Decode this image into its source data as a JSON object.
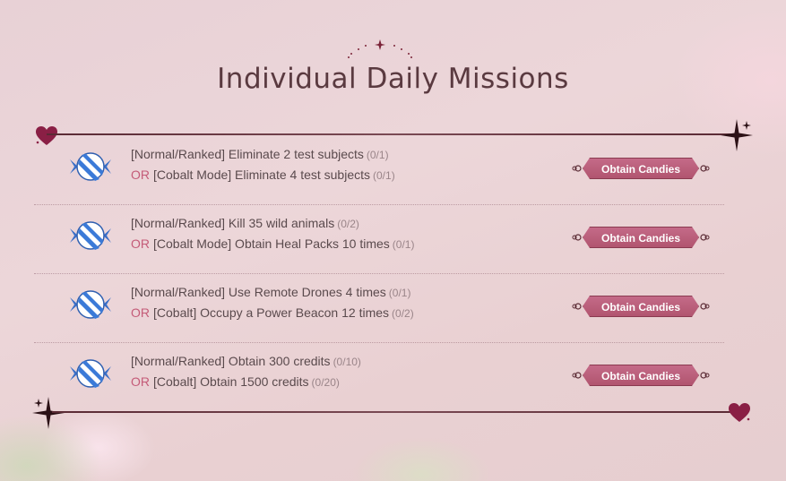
{
  "title": "Individual Daily Missions",
  "colors": {
    "accent": "#b1556f",
    "or_text": "#c45b78",
    "divider": "#5a2a34",
    "heart": "#8a1f45"
  },
  "missions": [
    {
      "line1": "[Normal/Ranked] Eliminate 2 test subjects",
      "progress1": "(0/1)",
      "or_label": "OR",
      "line2": "[Cobalt Mode] Eliminate 4 test subjects",
      "progress2": "(0/1)",
      "button": "Obtain Candies",
      "icon": "candy-icon"
    },
    {
      "line1": "[Normal/Ranked] Kill 35 wild animals",
      "progress1": "(0/2)",
      "or_label": "OR",
      "line2": "[Cobalt Mode] Obtain Heal Packs 10 times",
      "progress2": "(0/1)",
      "button": "Obtain Candies",
      "icon": "candy-icon"
    },
    {
      "line1": "[Normal/Ranked] Use Remote Drones 4 times",
      "progress1": "(0/1)",
      "or_label": "OR",
      "line2": "[Cobalt] Occupy a Power Beacon 12 times",
      "progress2": "(0/2)",
      "button": "Obtain Candies",
      "icon": "candy-icon"
    },
    {
      "line1": "[Normal/Ranked] Obtain 300 credits",
      "progress1": "(0/10)",
      "or_label": "OR",
      "line2": "[Cobalt] Obtain 1500 credits",
      "progress2": "(0/20)",
      "button": "Obtain Candies",
      "icon": "candy-icon"
    }
  ]
}
